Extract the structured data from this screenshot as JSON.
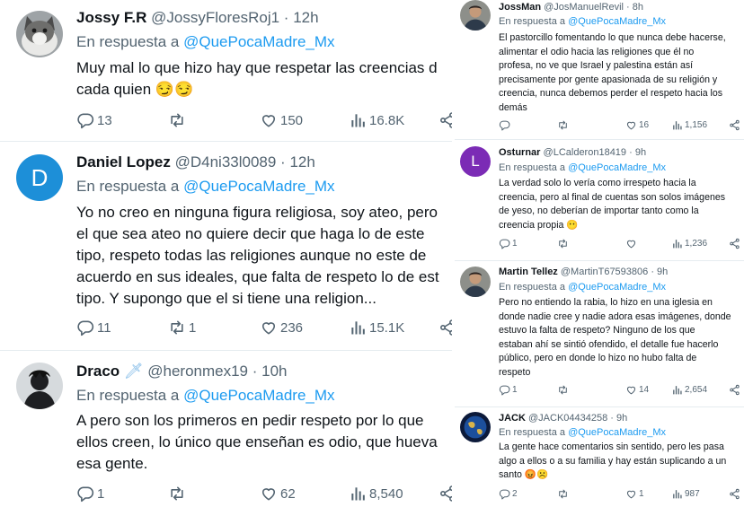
{
  "left_tweets": [
    {
      "name": "Jossy F.R",
      "handle": "@JossyFloresRoj1",
      "time": "12h",
      "reply_prefix": "En respuesta a",
      "reply_mention": "@QuePocaMadre_Mx",
      "lines": [
        "Muy mal lo que hizo hay que respetar las creencias d",
        "cada quien 😏😏"
      ],
      "replies": "13",
      "retweets": "",
      "likes": "150",
      "views": "16.8K",
      "avatar_icon": "cat-photo"
    },
    {
      "name": "Daniel Lopez",
      "handle": "@D4ni33l0089",
      "time": "12h",
      "reply_prefix": "En respuesta a",
      "reply_mention": "@QuePocaMadre_Mx",
      "avatar_letter": "D",
      "avatar_color": "#1d8fd8",
      "lines": [
        "Yo no creo en ninguna figura religiosa, soy ateo, pero",
        "el que sea ateo no quiere decir que haga lo de este",
        "tipo, respeto todas las religiones aunque no este de",
        "acuerdo en sus ideales, que falta de respeto lo de est",
        "tipo. Y supongo que el si tiene una religion..."
      ],
      "replies": "11",
      "retweets": "1",
      "likes": "236",
      "views": "15.1K"
    },
    {
      "name": "Draco",
      "name_emoji": "🗡",
      "handle": "@heronmex19",
      "time": "10h",
      "reply_prefix": "En respuesta a",
      "reply_mention": "@QuePocaMadre_Mx",
      "lines": [
        "A pero son los primeros en pedir respeto por lo que",
        "ellos creen, lo único que enseñan es odio, que hueva",
        "esa gente."
      ],
      "replies": "1",
      "retweets": "",
      "likes": "62",
      "views": "8,540",
      "avatar_icon": "silhouette-photo"
    }
  ],
  "right_tweets": [
    {
      "name": "JossMan",
      "handle": "@JosManuelRevil",
      "time": "8h",
      "reply_prefix": "En respuesta a",
      "reply_mention": "@QuePocaMadre_Mx",
      "lines": [
        "El pastorcillo fomentando lo que nunca debe hacerse,",
        "alimentar el odio hacia las religiones que él no",
        "profesa, no ve que Israel y palestina están así",
        "precisamente por gente apasionada de su religión y",
        "creencia, nunca debemos perder el respeto hacia los",
        "demás"
      ],
      "replies": "",
      "retweets": "",
      "likes": "16",
      "views": "1,156",
      "avatar_icon": "person-photo"
    },
    {
      "name": "Osturnar",
      "handle": "@LCalderon18419",
      "time": "9h",
      "reply_prefix": "En respuesta a",
      "reply_mention": "@QuePocaMadre_Mx",
      "avatar_letter": "L",
      "avatar_color": "#7b2bb5",
      "lines": [
        "La verdad solo lo vería como irrespeto hacia la",
        "creencia, pero al final de cuentas son solos imágenes",
        "de yeso, no deberían de importar tanto como la",
        "creencia propia 😶"
      ],
      "replies": "1",
      "retweets": "",
      "likes": "",
      "views": "1,236"
    },
    {
      "name": "Martin Tellez",
      "handle": "@MartinT67593806",
      "time": "9h",
      "reply_prefix": "En respuesta a",
      "reply_mention": "@QuePocaMadre_Mx",
      "lines": [
        "Pero no entiendo la rabia, lo hizo en una iglesia en",
        "donde nadie cree y nadie adora esas imágenes, donde",
        "estuvo la falta de respeto? Ninguno de los que",
        "estaban ahí se sintió ofendido, el detalle fue hacerlo",
        "público, pero en donde lo hizo no hubo falta de",
        "respeto"
      ],
      "replies": "1",
      "retweets": "",
      "likes": "14",
      "views": "2,654",
      "avatar_icon": "person-photo"
    },
    {
      "name": "JACK",
      "handle": "@JACK04434258",
      "time": "9h",
      "reply_prefix": "En respuesta a",
      "reply_mention": "@QuePocaMadre_Mx",
      "lines": [
        "La gente hace comentarios sin sentido, pero les pasa",
        "algo a ellos o a su familia y hay están suplicando a un",
        "santo 😡☹️"
      ],
      "replies": "2",
      "retweets": "",
      "likes": "1",
      "views": "987",
      "avatar_icon": "earth-photo"
    }
  ]
}
